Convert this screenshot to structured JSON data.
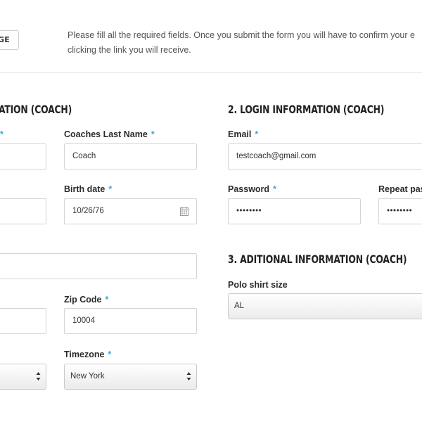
{
  "top": {
    "button_label": "AGE",
    "intro_line1": "Please fill all the required fields. Once you submit the form you will have to confirm your e",
    "intro_line2": "clicking the link you will receive."
  },
  "section1": {
    "heading": "ATION (COACH)",
    "first_name_req": "*",
    "last_name_label": "Coaches Last Name",
    "last_name_value": "Coach",
    "first_name_value": "",
    "birth_date_label": "Birth date",
    "birth_date_value": "10/26/76",
    "address_value": "",
    "city_value": "",
    "zip_label": "Zip Code",
    "zip_value": "10004",
    "state_value": "",
    "timezone_label": "Timezone",
    "timezone_value": "New York"
  },
  "section2": {
    "heading": "2. LOGIN INFORMATION (COACH)",
    "email_label": "Email",
    "email_value": "testcoach@gmail.com",
    "password_label": "Password",
    "password_value": "••••••••",
    "repeat_label": "Repeat pas",
    "repeat_value": "••••••••"
  },
  "section3": {
    "heading": "3. ADITIONAL INFORMATION (COACH)",
    "polo_label": "Polo shirt size",
    "polo_value": "AL"
  },
  "required_marker": "*",
  "colors": {
    "required": "#3aa8d8",
    "border": "#d4d4d4"
  }
}
